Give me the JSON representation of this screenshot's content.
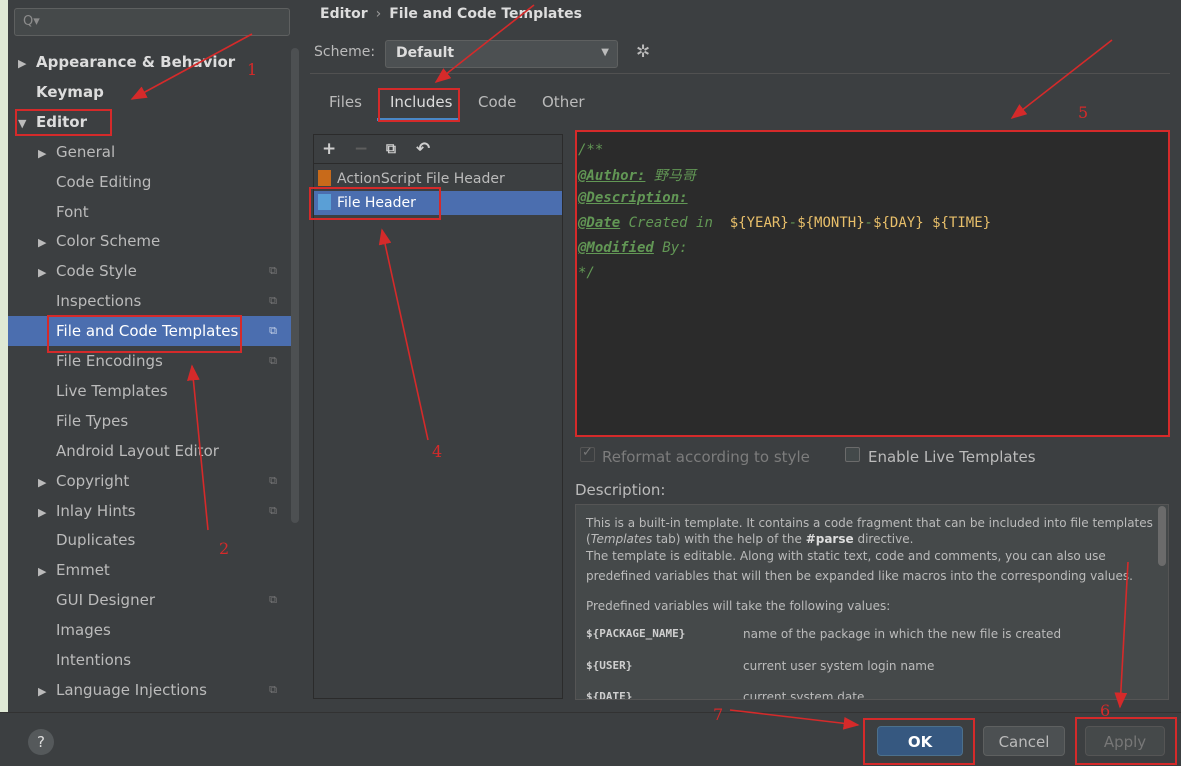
{
  "search": {
    "placeholder": "Q▾"
  },
  "sidebar": {
    "items": [
      {
        "label": "Appearance & Behavior",
        "arrow": "▶",
        "copy": ""
      },
      {
        "label": "Keymap",
        "arrow": "",
        "copy": ""
      },
      {
        "label": "Editor",
        "arrow": "▼",
        "copy": ""
      },
      {
        "label": "General",
        "arrow": "▶",
        "copy": ""
      },
      {
        "label": "Code Editing",
        "arrow": "",
        "copy": ""
      },
      {
        "label": "Font",
        "arrow": "",
        "copy": ""
      },
      {
        "label": "Color Scheme",
        "arrow": "▶",
        "copy": ""
      },
      {
        "label": "Code Style",
        "arrow": "▶",
        "copy": "⧉"
      },
      {
        "label": "Inspections",
        "arrow": "",
        "copy": "⧉"
      },
      {
        "label": "File and Code Templates",
        "arrow": "",
        "copy": "⧉"
      },
      {
        "label": "File Encodings",
        "arrow": "",
        "copy": "⧉"
      },
      {
        "label": "Live Templates",
        "arrow": "",
        "copy": ""
      },
      {
        "label": "File Types",
        "arrow": "",
        "copy": ""
      },
      {
        "label": "Android Layout Editor",
        "arrow": "",
        "copy": ""
      },
      {
        "label": "Copyright",
        "arrow": "▶",
        "copy": "⧉"
      },
      {
        "label": "Inlay Hints",
        "arrow": "▶",
        "copy": "⧉"
      },
      {
        "label": "Duplicates",
        "arrow": "",
        "copy": ""
      },
      {
        "label": "Emmet",
        "arrow": "▶",
        "copy": ""
      },
      {
        "label": "GUI Designer",
        "arrow": "",
        "copy": "⧉"
      },
      {
        "label": "Images",
        "arrow": "",
        "copy": ""
      },
      {
        "label": "Intentions",
        "arrow": "",
        "copy": ""
      },
      {
        "label": "Language Injections",
        "arrow": "▶",
        "copy": "⧉"
      }
    ]
  },
  "breadcrumb": {
    "parent": "Editor",
    "sep": "›",
    "current": "File and Code Templates"
  },
  "scheme": {
    "label": "Scheme:",
    "value": "Default",
    "dropdown": "▼",
    "gear": "✲"
  },
  "tabs": [
    "Files",
    "Includes",
    "Code",
    "Other"
  ],
  "toolbar": {
    "add": "+",
    "remove": "−",
    "copy": "⧉",
    "reset": "↶"
  },
  "templates": [
    "ActionScript File Header",
    "File Header"
  ],
  "editor": {
    "line1": "/**",
    "author_tag": "@Author:",
    "author_value": " 野马哥",
    "desc_tag": "@Description:",
    "date_tag": "@Date",
    "date_text": " Created in  ",
    "year": "${YEAR}",
    "dash1": "-",
    "month": "${MONTH}",
    "dash2": "-",
    "day": "${DAY}",
    "space": " ",
    "time": "${TIME}",
    "mod_tag": "@Modified",
    "mod_text": " By:",
    "end": "*/"
  },
  "options": {
    "reformat": "Reformat according to style",
    "reformat_checked": true,
    "live": "Enable Live Templates",
    "live_checked": false
  },
  "description": {
    "label": "Description:",
    "line1": "This is a built-in template. It contains a code fragment that can be included into file templates",
    "line2a": "(",
    "line2b": "Templates",
    "line2c": " tab) with the help of the ",
    "line2d": "#parse",
    "line2e": " directive.",
    "line3": "The template is editable. Along with static text, code and comments, you can also use",
    "line4": "predefined variables that will then be expanded like macros into the corresponding values.",
    "line5": "Predefined variables will take the following values:",
    "vars": [
      {
        "name": "${PACKAGE_NAME}",
        "desc": "name of the package in which the new file is created"
      },
      {
        "name": "${USER}",
        "desc": "current user system login name"
      },
      {
        "name": "${DATE}",
        "desc": "current system date"
      }
    ]
  },
  "footer": {
    "help": "?",
    "ok": "OK",
    "cancel": "Cancel",
    "apply": "Apply"
  },
  "annotations": {
    "n1": "1",
    "n2": "2",
    "n4": "4",
    "n5": "5",
    "n6": "6",
    "n7": "7",
    "color": "#d52a2a"
  }
}
